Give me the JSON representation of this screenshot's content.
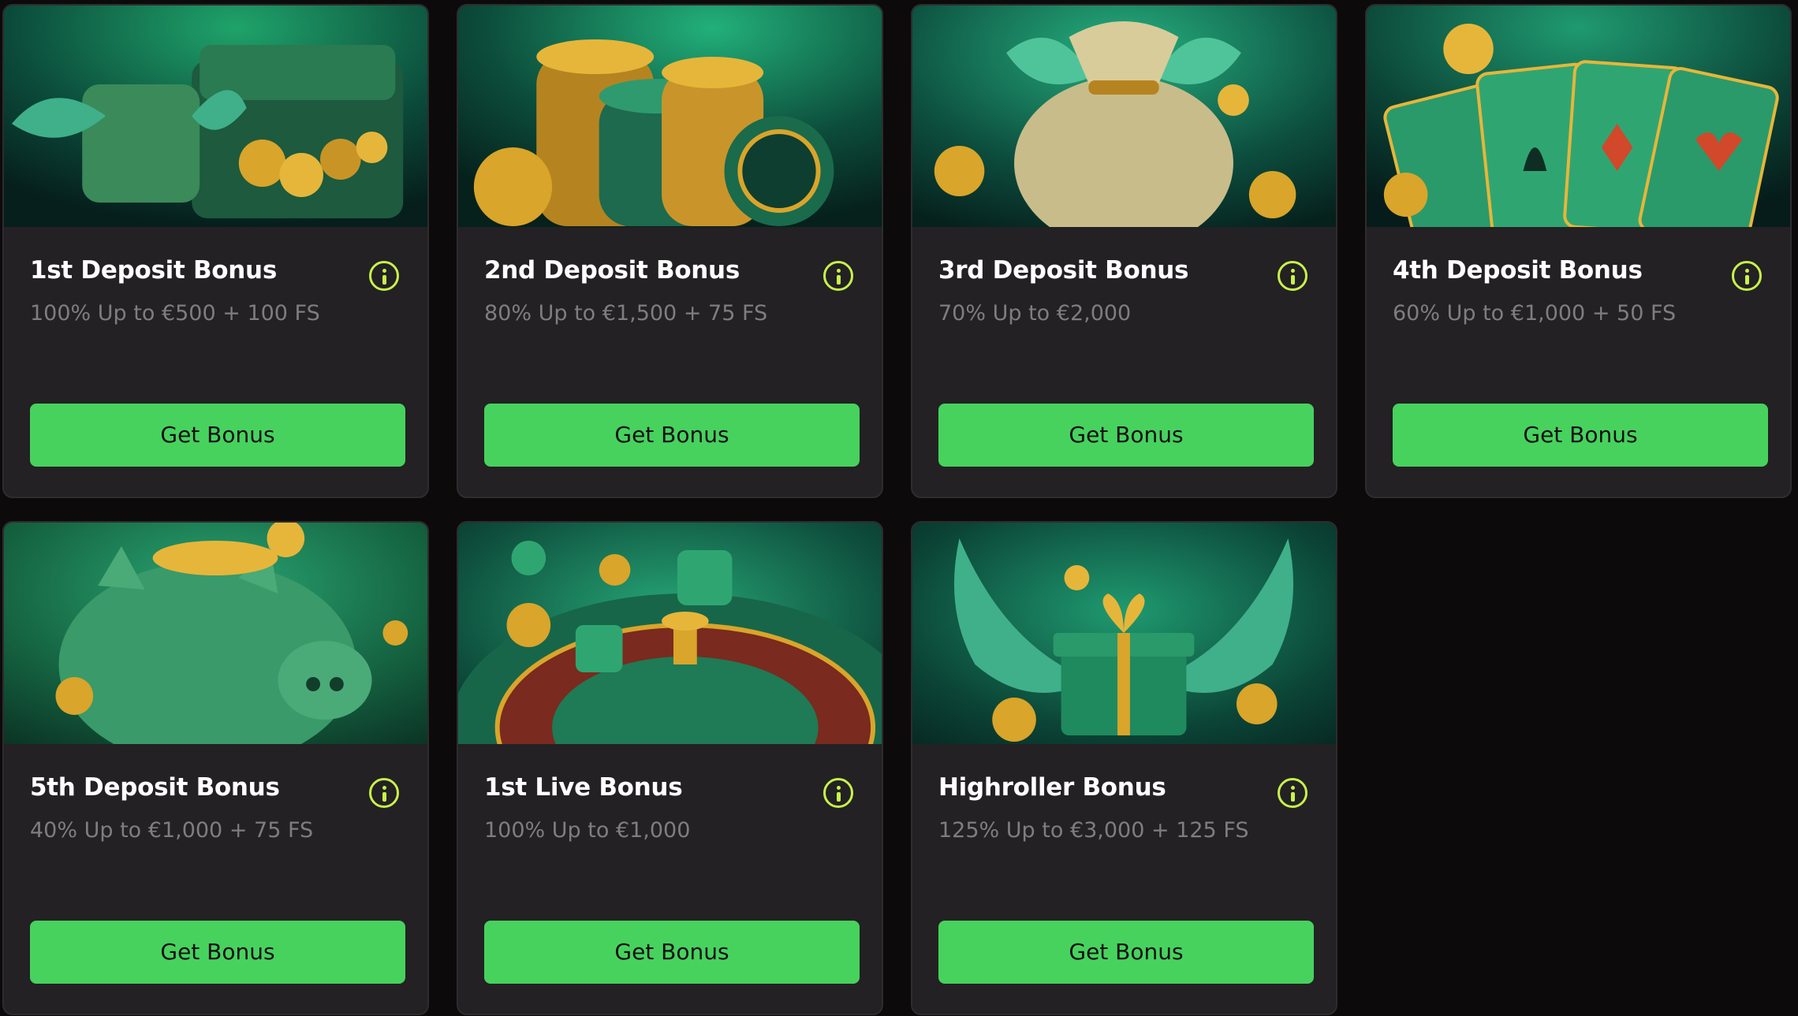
{
  "bonuses": [
    {
      "title": "1st Deposit Bonus",
      "subtitle": "100% Up to €500 + 100 FS",
      "button": "Get Bonus",
      "art_number": "1"
    },
    {
      "title": "2nd Deposit Bonus",
      "subtitle": "80% Up to €1,500 + 75 FS",
      "button": "Get Bonus",
      "art_number": "2"
    },
    {
      "title": "3rd Deposit Bonus",
      "subtitle": "70% Up to €2,000",
      "button": "Get Bonus",
      "art_number": "3"
    },
    {
      "title": "4th Deposit Bonus",
      "subtitle": "60% Up to €1,000 + 50 FS",
      "button": "Get Bonus",
      "art_number": ""
    },
    {
      "title": "5th Deposit Bonus",
      "subtitle": "40% Up to €1,000 + 75 FS",
      "button": "Get Bonus",
      "art_number": "5"
    },
    {
      "title": "1st Live Bonus",
      "subtitle": "100% Up to €1,000",
      "button": "Get Bonus",
      "art_number": ""
    },
    {
      "title": "Highroller Bonus",
      "subtitle": "125% Up to €3,000 + 125 FS",
      "button": "Get Bonus",
      "art_number": ""
    }
  ],
  "colors": {
    "background": "#0c0a0a",
    "card": "#232123",
    "button": "#47d25e",
    "info_icon": "#c8f24a",
    "title": "#ffffff",
    "subtitle": "#7f7d80"
  }
}
